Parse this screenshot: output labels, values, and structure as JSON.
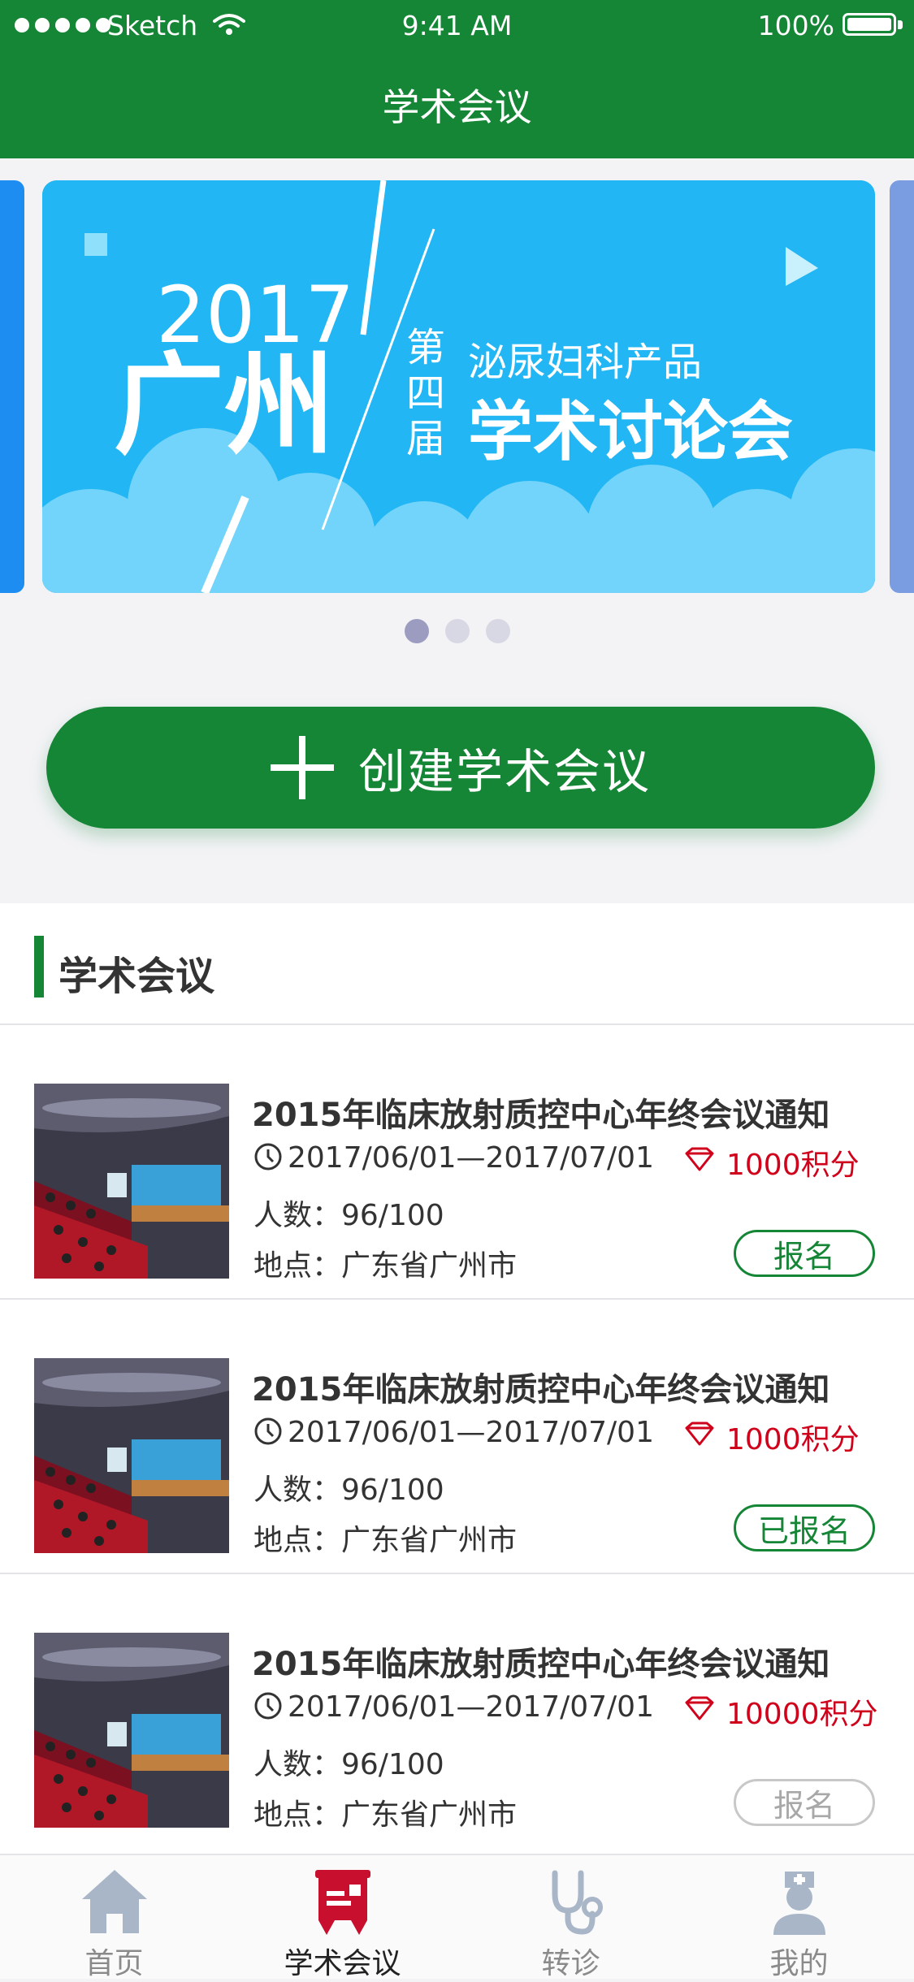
{
  "status_bar": {
    "carrier": "Sketch",
    "time": "9:41 AM",
    "battery": "100%"
  },
  "nav": {
    "title": "学术会议"
  },
  "banner": {
    "year": "2017",
    "city": "广州",
    "ordinal": "第四届",
    "subtitle": "泌尿妇科产品",
    "title": "学术讨论会",
    "page_count": 3,
    "active_page": 1
  },
  "create_button": {
    "label": "创建学术会议"
  },
  "section": {
    "title": "学术会议"
  },
  "items": [
    {
      "title": "2015年临床放射质控中心年终会议通知",
      "date": "2017/06/01—2017/07/01",
      "points": "1000积分",
      "count": "人数：96/100",
      "location": "地点：广东省广州市",
      "action": "报名"
    },
    {
      "title": "2015年临床放射质控中心年终会议通知",
      "date": "2017/06/01—2017/07/01",
      "points": "1000积分",
      "count": "人数：96/100",
      "location": "地点：广东省广州市",
      "action": "已报名"
    },
    {
      "title": "2015年临床放射质控中心年终会议通知",
      "date": "2017/06/01—2017/07/01",
      "points": "10000积分",
      "count": "人数：96/100",
      "location": "地点：广东省广州市",
      "action": "报名"
    }
  ],
  "tabs": [
    {
      "label": "首页",
      "icon": "home-icon"
    },
    {
      "label": "学术会议",
      "icon": "conference-icon"
    },
    {
      "label": "转诊",
      "icon": "stethoscope-icon"
    },
    {
      "label": "我的",
      "icon": "doctor-icon"
    }
  ],
  "colors": {
    "brand_green": "#158536",
    "banner_blue": "#22b6f4",
    "points_red": "#d0021b"
  }
}
